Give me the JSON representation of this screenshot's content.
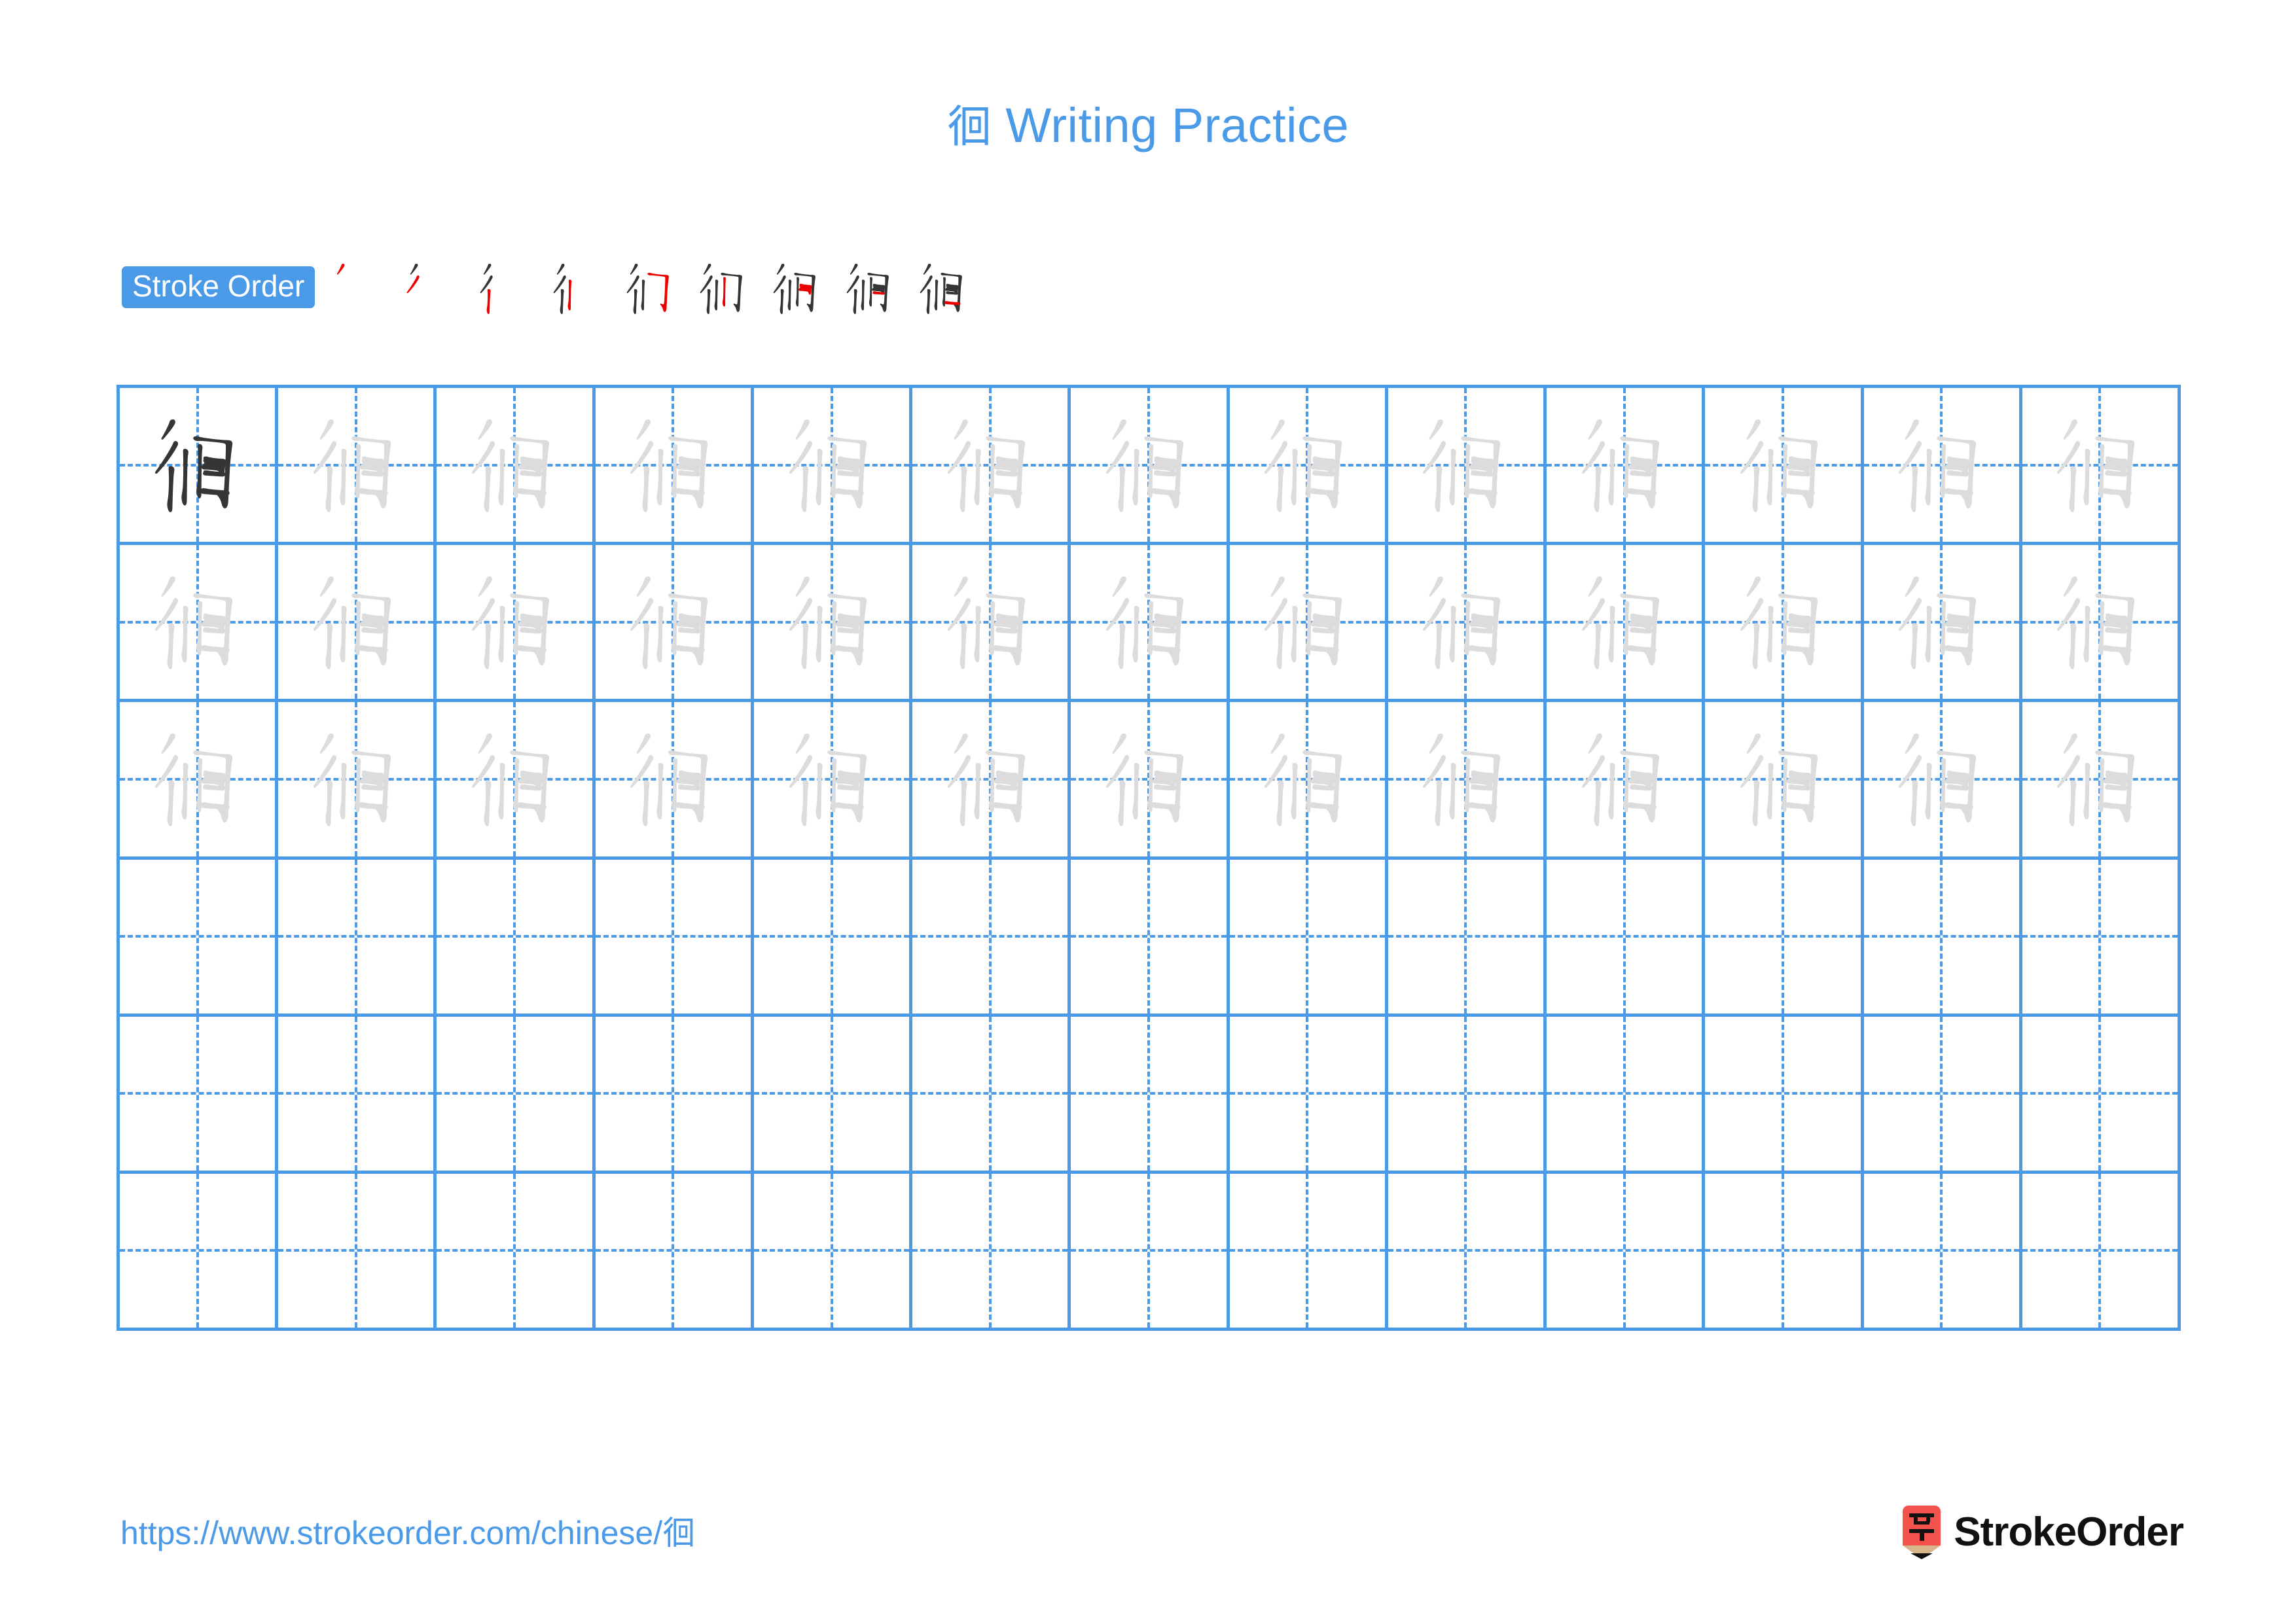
{
  "character": "徊",
  "colors": {
    "accent_blue": "#4a9ae8",
    "grid_line": "#4a9ae8",
    "model_char": "#353535",
    "trace_char": "#dcdcdc",
    "new_stroke_red": "#ee0000",
    "logo_red": "#f4524d",
    "logo_wood": "#d8b48a",
    "brand_text": "#111111"
  },
  "header": {
    "title_char": "徊",
    "title_text": " Writing Practice"
  },
  "stroke_order": {
    "badge_label": "Stroke Order",
    "total_strokes": 9,
    "steps": [
      {
        "index": 1,
        "name": "stroke-step-1",
        "stroke_added": "撇 piě"
      },
      {
        "index": 2,
        "name": "stroke-step-2",
        "stroke_added": "撇 piě"
      },
      {
        "index": 3,
        "name": "stroke-step-3",
        "stroke_added": "竖 shù"
      },
      {
        "index": 4,
        "name": "stroke-step-4",
        "stroke_added": "竖 shù"
      },
      {
        "index": 5,
        "name": "stroke-step-5",
        "stroke_added": "横折 héngzhé"
      },
      {
        "index": 6,
        "name": "stroke-step-6",
        "stroke_added": "竖 shù"
      },
      {
        "index": 7,
        "name": "stroke-step-7",
        "stroke_added": "横折 héngzhé"
      },
      {
        "index": 8,
        "name": "stroke-step-8",
        "stroke_added": "横 héng"
      },
      {
        "index": 9,
        "name": "stroke-step-9",
        "stroke_added": "横 héng"
      }
    ]
  },
  "grid": {
    "columns": 13,
    "rows": 6,
    "cells": [
      [
        "model",
        "trace",
        "trace",
        "trace",
        "trace",
        "trace",
        "trace",
        "trace",
        "trace",
        "trace",
        "trace",
        "trace",
        "trace"
      ],
      [
        "trace",
        "trace",
        "trace",
        "trace",
        "trace",
        "trace",
        "trace",
        "trace",
        "trace",
        "trace",
        "trace",
        "trace",
        "trace"
      ],
      [
        "trace",
        "trace",
        "trace",
        "trace",
        "trace",
        "trace",
        "trace",
        "trace",
        "trace",
        "trace",
        "trace",
        "trace",
        "trace"
      ],
      [
        "empty",
        "empty",
        "empty",
        "empty",
        "empty",
        "empty",
        "empty",
        "empty",
        "empty",
        "empty",
        "empty",
        "empty",
        "empty"
      ],
      [
        "empty",
        "empty",
        "empty",
        "empty",
        "empty",
        "empty",
        "empty",
        "empty",
        "empty",
        "empty",
        "empty",
        "empty",
        "empty"
      ],
      [
        "empty",
        "empty",
        "empty",
        "empty",
        "empty",
        "empty",
        "empty",
        "empty",
        "empty",
        "empty",
        "empty",
        "empty",
        "empty"
      ]
    ]
  },
  "footer": {
    "url_text": "https://www.strokeorder.com/chinese/",
    "url_char": "徊",
    "brand_name": "StrokeOrder",
    "brand_mark_char": "字"
  }
}
